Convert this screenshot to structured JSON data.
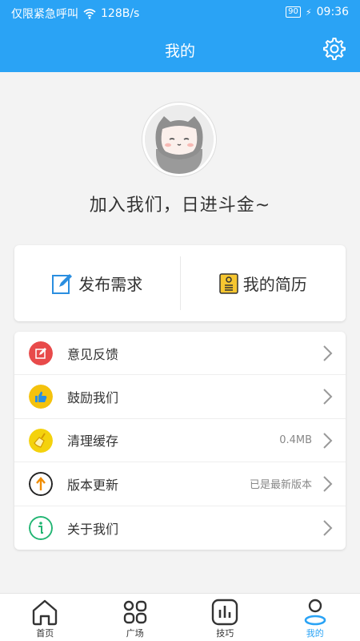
{
  "status_bar": {
    "carrier": "仅限紧急呼叫",
    "network_speed": "128B/s",
    "battery": "90",
    "time": "09:36"
  },
  "header": {
    "title": "我的",
    "settings_icon": "gear-icon"
  },
  "profile": {
    "slogan": "加入我们，日进斗金~"
  },
  "actions": [
    {
      "label": "发布需求",
      "icon": "edit-icon"
    },
    {
      "label": "我的简历",
      "icon": "resume-icon"
    }
  ],
  "menu": [
    {
      "label": "意见反馈",
      "value": "",
      "icon": "feedback-icon",
      "color": "#e84a4a"
    },
    {
      "label": "鼓励我们",
      "value": "",
      "icon": "thumbs-up-icon",
      "color": "#f4c20d"
    },
    {
      "label": "清理缓存",
      "value": "0.4MB",
      "icon": "broom-icon",
      "color": "#f4d20d"
    },
    {
      "label": "版本更新",
      "value": "已是最新版本",
      "icon": "update-arrow-icon",
      "color": "#f08c00"
    },
    {
      "label": "关于我们",
      "value": "",
      "icon": "info-icon",
      "color": "#22b573"
    }
  ],
  "tabs": [
    {
      "label": "首页",
      "icon": "home-icon",
      "active": false
    },
    {
      "label": "广场",
      "icon": "grid-icon",
      "active": false
    },
    {
      "label": "技巧",
      "icon": "chart-icon",
      "active": false
    },
    {
      "label": "我的",
      "icon": "person-icon",
      "active": true
    }
  ],
  "colors": {
    "primary": "#2aa3f5",
    "background": "#f3f3f3"
  }
}
